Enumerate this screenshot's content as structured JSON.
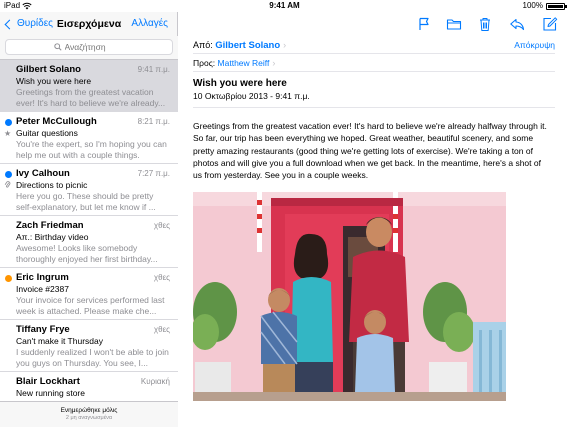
{
  "status_bar": {
    "carrier": "iPad",
    "wifi_icon": "wifi-icon",
    "time": "9:41 AM",
    "battery_percent": "100%",
    "battery_icon": "battery-icon"
  },
  "sidebar": {
    "back_label": "Θυρίδες",
    "title": "Εισερχόμενα",
    "edit_label": "Αλλαγές",
    "search_placeholder": "Αναζήτηση",
    "messages": [
      {
        "sender": "Gilbert Solano",
        "date": "9:41 π.μ.",
        "subject": "Wish you were here",
        "preview": "Greetings from the greatest vacation ever! It's hard to believe we're already...",
        "unread": false,
        "selected": true,
        "indicator": "",
        "colors": {
          "dot": ""
        }
      },
      {
        "sender": "Peter McCullough",
        "date": "8:21 π.μ.",
        "subject": "Guitar questions",
        "preview": "You're the expert, so I'm hoping you can help me out with a couple things.",
        "unread": true,
        "selected": false,
        "indicator": "star-icon",
        "colors": {
          "dot": "#007aff"
        }
      },
      {
        "sender": "Ivy Calhoun",
        "date": "7:27 π.μ.",
        "subject": "Directions to picnic",
        "preview": "Here you go. These should be pretty self-explanatory, but let me know if ...",
        "unread": true,
        "selected": false,
        "indicator": "paperclip-icon",
        "colors": {
          "dot": "#007aff"
        }
      },
      {
        "sender": "Zach Friedman",
        "date": "χθες",
        "subject": "Απ.: Birthday video",
        "preview": "Awesome! Looks like somebody thoroughly enjoyed her first birthday...",
        "unread": false,
        "selected": false,
        "indicator": "",
        "colors": {
          "dot": ""
        }
      },
      {
        "sender": "Eric Ingrum",
        "date": "χθες",
        "subject": "Invoice #2387",
        "preview": "Your invoice for services performed last week is attached. Please make che...",
        "unread": false,
        "selected": false,
        "indicator": "",
        "colors": {
          "dot": "#ff9500"
        }
      },
      {
        "sender": "Tiffany Frye",
        "date": "χθες",
        "subject": "Can't make it Thursday",
        "preview": "I suddenly realized I won't be able to join you guys on Thursday. You see, I...",
        "unread": false,
        "selected": false,
        "indicator": "",
        "colors": {
          "dot": ""
        }
      },
      {
        "sender": "Blair Lockhart",
        "date": "Κυριακή",
        "subject": "New running store",
        "preview": "",
        "unread": false,
        "selected": false,
        "indicator": "",
        "colors": {
          "dot": ""
        }
      }
    ],
    "footer_status": "Ενημερώθηκε μόλις",
    "footer_sub": "2 μη αναγνωσμένα"
  },
  "detail": {
    "toolbar_icons": [
      "flag-icon",
      "folder-icon",
      "trash-icon",
      "reply-icon",
      "compose-icon"
    ],
    "from_label": "Από:",
    "from_name": "Gilbert Solano",
    "hide_label": "Απόκρυψη",
    "to_label": "Προς:",
    "to_name": "Matthew Reiff",
    "subject": "Wish you were here",
    "date": "10 Οκτωβρίου 2013 - 9:41 π.μ.",
    "body": "Greetings from the greatest vacation ever! It's hard to believe we're already halfway through it. So far, our trip has been everything we hoped. Great weather, beautiful scenery, and some pretty amazing restaurants (good thing we're getting lots of exercise). We're taking a ton of photos and will give you a full download when we get back. In the meantime, here's a shot of us from yesterday. See you in a couple weeks."
  },
  "colors": {
    "accent": "#007aff",
    "unread_dot": "#007aff",
    "flag_dot": "#ff9500",
    "selected_row": "#d9d9de",
    "secondary_text": "#8e8e93"
  }
}
